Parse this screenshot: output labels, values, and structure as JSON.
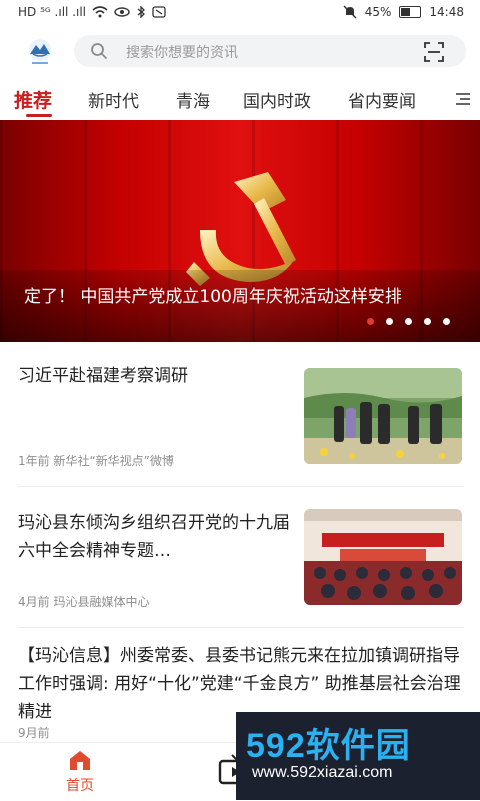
{
  "status_bar": {
    "left_indicators": "HD ⁵ᴳ .ıll .ıll",
    "battery": "45%",
    "battery_level": 0.45,
    "time": "14:48"
  },
  "header": {
    "search_placeholder": "搜索你想要的资讯"
  },
  "tabs": [
    {
      "label": "推荐",
      "active": true
    },
    {
      "label": "新时代"
    },
    {
      "label": "青海"
    },
    {
      "label": "国内时政"
    },
    {
      "label": "省内要闻"
    }
  ],
  "banner": {
    "caption": "定了！ 中国共产党成立100周年庆祝活动这样安排",
    "slide_count": 5,
    "active_slide": 1
  },
  "news": [
    {
      "title": "习近平赴福建考察调研",
      "meta": "1年前  新华社“新华视点”微博"
    },
    {
      "title": "玛沁县东倾沟乡组织召开党的十九届六中全会精神专题…",
      "meta": "4月前  玛沁县融媒体中心"
    },
    {
      "title": "【玛沁信息】州委常委、县委书记熊元来在拉加镇调研指导工作时强调:  用好“十化”党建“千金良方” 助推基层社会治理精进",
      "meta": "9月前"
    }
  ],
  "bottom_nav": {
    "home": "首页"
  },
  "watermark": {
    "brand": "592软件园",
    "url": "www.592xiazai.com"
  },
  "colors": {
    "accent": "#c81e1e",
    "nav_active": "#e04a2f"
  }
}
